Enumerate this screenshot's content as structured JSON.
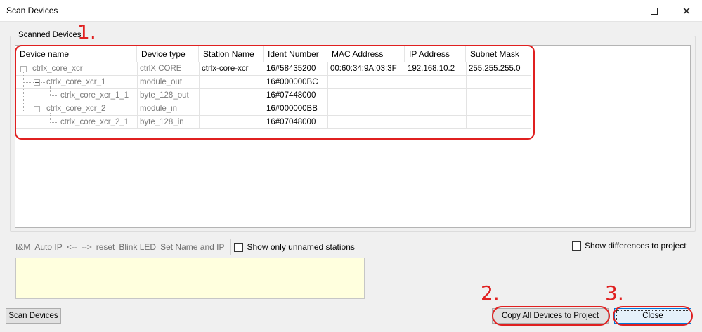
{
  "window": {
    "title": "Scan Devices"
  },
  "group": {
    "legend": "Scanned Devices"
  },
  "table": {
    "columns": [
      "Device name",
      "Device type",
      "Station Name",
      "Ident Number",
      "MAC Address",
      "IP Address",
      "Subnet Mask"
    ],
    "rows": [
      [
        "ctrlx_core_xcr",
        "ctrlX CORE",
        "ctrlx-core-xcr",
        "16#58435200",
        "00:60:34:9A:03:3F",
        "192.168.10.2",
        "255.255.255.0"
      ],
      [
        "ctrlx_core_xcr_1",
        "module_out",
        "",
        "16#000000BC",
        "",
        "",
        ""
      ],
      [
        "ctrlx_core_xcr_1_1",
        "byte_128_out",
        "",
        "16#07448000",
        "",
        "",
        ""
      ],
      [
        "ctrlx_core_xcr_2",
        "module_in",
        "",
        "16#000000BB",
        "",
        "",
        ""
      ],
      [
        "ctrlx_core_xcr_2_1",
        "byte_128_in",
        "",
        "16#07048000",
        "",
        "",
        ""
      ]
    ]
  },
  "toolbar": {
    "im": "I&M",
    "auto_ip": "Auto IP",
    "prev": "<--",
    "next": "-->",
    "reset": "reset",
    "blink": "Blink LED",
    "set_name": "Set Name and IP",
    "unnamed": "Show only unnamed stations"
  },
  "differences": "Show differences to project",
  "buttons": {
    "scan": "Scan Devices",
    "copy": "Copy All Devices to Project",
    "close": "Close"
  },
  "annotations": {
    "one": "1.",
    "two": "2.",
    "three": "3."
  },
  "icons": {
    "minimize": "minimize-icon",
    "maximize": "maximize-icon",
    "close": "close-icon",
    "tree": "tree-collapse-icon"
  },
  "colors": {
    "annotation": "#e02020",
    "log_bg": "#ffffde",
    "focus": "#0078d7"
  }
}
